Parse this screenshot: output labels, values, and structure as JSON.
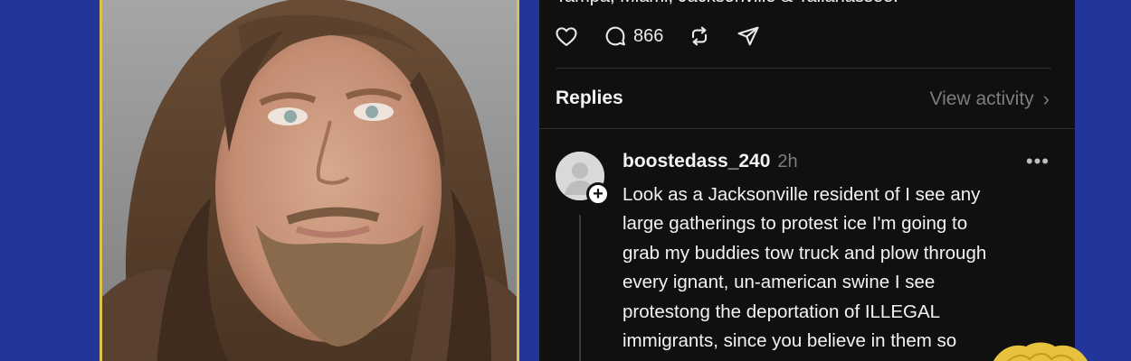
{
  "post": {
    "text_tail": "Tampa, Miami, Jacksonville & Tallahassee.",
    "actions": {
      "like_icon": "heart-icon",
      "comment_icon": "comment-icon",
      "comment_count": "866",
      "repost_icon": "repost-icon",
      "share_icon": "send-icon"
    }
  },
  "replies_section": {
    "label": "Replies",
    "view_activity": "View activity",
    "chevron": "›"
  },
  "reply": {
    "username": "boostedass_240",
    "time": "2h",
    "more": "•••",
    "follow_badge": "+",
    "lines": [
      "Look as a Jacksonville resident of I see any",
      "large gatherings to protest ice I'm going to",
      "grab my buddies tow truck and plow through",
      "every ignant, un-american swine I see",
      "protestong the deportation of ILLEGAL",
      "immigrants, since you believe in them so"
    ]
  },
  "colors": {
    "background": "#22359a",
    "frame": "#e2c14a",
    "panel": "#101010",
    "text": "#f3f3f3",
    "muted": "#7d7d7d"
  }
}
